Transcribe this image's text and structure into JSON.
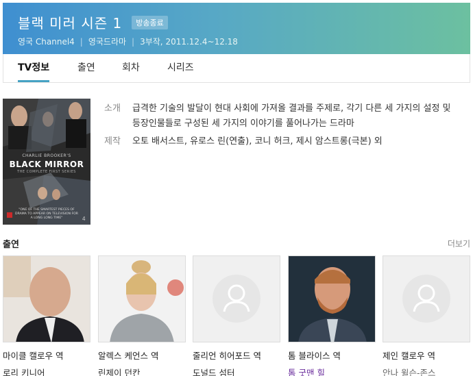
{
  "header": {
    "title": "블랙 미러 시즌 1",
    "badge": "방송종료",
    "meta": [
      "영국 Channel4",
      "영국드라마",
      "3부작, 2011.12.4~12.18"
    ]
  },
  "tabs": [
    {
      "label": "TV정보",
      "active": true
    },
    {
      "label": "출연",
      "active": false
    },
    {
      "label": "회차",
      "active": false
    },
    {
      "label": "시리즈",
      "active": false
    }
  ],
  "poster": {
    "subtitle": "CHARLIE BROOKER'S",
    "brand": "BLACK MIRROR",
    "tagline": "THE COMPLETE FIRST SERIES",
    "quote": "\"ONE OF THE SMARTEST PIECES OF DRAMA TO APPEAR ON TELEVISION FOR A LONG LONG TIME\""
  },
  "info": {
    "intro_label": "소개",
    "intro_text": "급격한 기술의 발달이 현대 사회에 가져올 결과를 주제로, 각기 다른 세 가지의 설정 및 등장인물들로 구성된 세 가지의 이야기를 풀어나가는 드라마",
    "credits_label": "제작",
    "credits_text": "오토 배서스트, 유로스 린(연출), 코니 허크, 제시 암스트롱(극본) 외"
  },
  "cast": {
    "heading": "출연",
    "more": "더보기",
    "members": [
      {
        "role": "마이클 캘로우 역",
        "actor": "로리 키니어",
        "photo": "photo"
      },
      {
        "role": "알렉스 케언스 역",
        "actor": "린제이 던칸",
        "photo": "photo"
      },
      {
        "role": "줄리언 히어포드 역",
        "actor": "도널드 섬터",
        "photo": "placeholder"
      },
      {
        "role": "톰 블라이스 역",
        "actor": "톰 굿맨 힐",
        "photo": "photo"
      },
      {
        "role": "제인 캘로우 역",
        "actor": "안나 윌슨-존스",
        "photo": "placeholder"
      }
    ]
  },
  "colors": {
    "header_gradient_start": "#3f8fd0",
    "header_gradient_end": "#6cc0a0",
    "tab_active_underline": "#46a2c4",
    "visited_link": "#6a2c9c"
  }
}
